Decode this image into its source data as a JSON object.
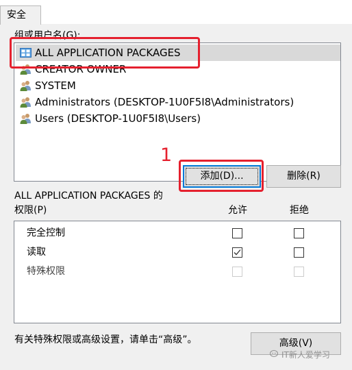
{
  "tabs": [
    {
      "label": "安全"
    }
  ],
  "groups": {
    "label": "组或用户名(G):",
    "items": [
      {
        "name": "ALL APPLICATION PACKAGES",
        "icon": "app-packages-icon",
        "selected": true
      },
      {
        "name": "CREATOR OWNER",
        "icon": "users-icon",
        "selected": false
      },
      {
        "name": "SYSTEM",
        "icon": "users-icon",
        "selected": false
      },
      {
        "name": "Administrators (DESKTOP-1U0F5I8\\Administrators)",
        "icon": "users-icon",
        "selected": false
      },
      {
        "name": "Users (DESKTOP-1U0F5I8\\Users)",
        "icon": "users-icon",
        "selected": false
      }
    ]
  },
  "buttons": {
    "add": "添加(D)...",
    "remove": "删除(R)",
    "advanced": "高级(V)"
  },
  "permissions": {
    "title": "ALL APPLICATION PACKAGES 的",
    "label": "权限(P)",
    "allow_header": "允许",
    "deny_header": "拒绝",
    "rows": [
      {
        "name": "完全控制",
        "allow": false,
        "deny": false,
        "disabled": false
      },
      {
        "name": "读取",
        "allow": true,
        "deny": false,
        "disabled": false
      },
      {
        "name": "特殊权限",
        "allow": false,
        "deny": false,
        "disabled": true
      }
    ]
  },
  "footer": {
    "text": "有关特殊权限或高级设置，请单击“高级”。"
  },
  "annotation": {
    "step_number": "1",
    "color": "#e5202e"
  },
  "watermark": {
    "text": "IT新人爱学习"
  },
  "colors": {
    "selection": "#d9d9d9",
    "focus": "#0078d7",
    "button_face": "#e1e1e1"
  }
}
